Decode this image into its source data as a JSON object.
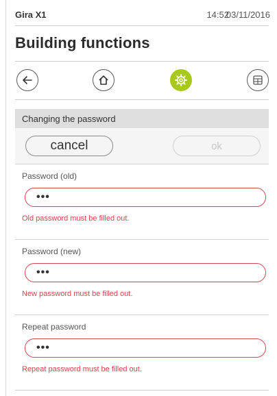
{
  "status": {
    "app_name": "Gira X1",
    "time": "14:52",
    "date": "03/11/2016"
  },
  "page": {
    "title": "Building functions"
  },
  "nav": {
    "back_icon": "arrow-left-icon",
    "home_icon": "home-icon",
    "settings_icon": "gear-icon",
    "grid_icon": "grid-icon",
    "active_color": "#a8c91c"
  },
  "section": {
    "title": "Changing the password"
  },
  "actions": {
    "cancel_label": "cancel",
    "ok_label": "ok"
  },
  "fields": [
    {
      "label": "Password (old)",
      "value": "•••",
      "error": "Old password must be filled out."
    },
    {
      "label": "Password (new)",
      "value": "•••",
      "error": "New password must be filled out."
    },
    {
      "label": "Repeat password",
      "value": "•••",
      "error": "Repeat password must be filled out."
    }
  ],
  "colors": {
    "error": "#d6454d",
    "header_bg": "#dedede"
  }
}
